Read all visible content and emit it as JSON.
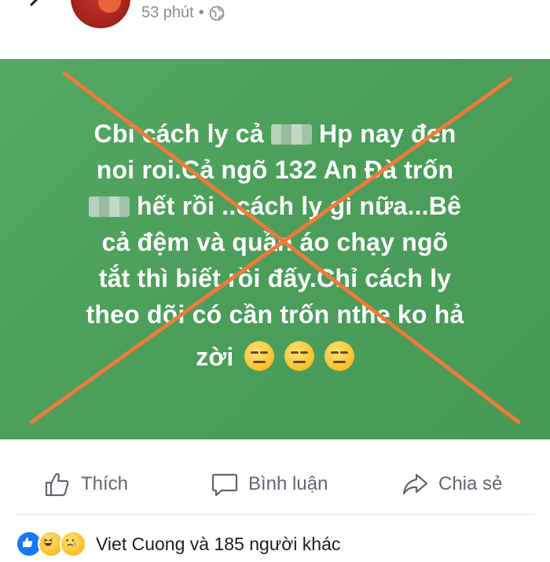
{
  "header": {
    "time": "53 phút",
    "dot": "•"
  },
  "post": {
    "background_color": "#4fa35e",
    "text_color": "#ffffff",
    "cross_color": "#ee7b3a",
    "lines": [
      [
        "Cbi cách ly cả ",
        "Hp nay đen"
      ],
      [
        "noi roi.Cả ngõ 132 An Đà trốn"
      ],
      [
        "hết rồi ..cách ly gì nữa...Bê"
      ],
      [
        "cả đệm và quần áo chạy ngõ"
      ],
      [
        "tắt thì biết rồi đấy.Chỉ cách ly"
      ],
      [
        "theo dõi có cần trốn nthe ko hả"
      ],
      [
        "zời"
      ]
    ]
  },
  "actions": {
    "like_label": "Thích",
    "comment_label": "Bình luận",
    "share_label": "Chia sẻ"
  },
  "reactions": {
    "summary": "Viet Cuong và 185 người khác",
    "icons": [
      "like-icon",
      "haha-icon",
      "sad-icon"
    ]
  }
}
